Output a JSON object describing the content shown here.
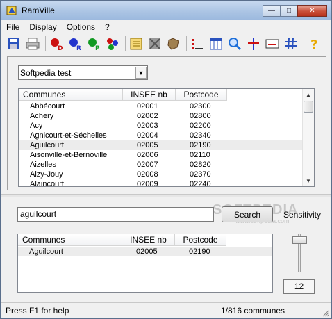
{
  "window": {
    "title": "RamVille",
    "minimize": "—",
    "maximize": "□",
    "close": "✕"
  },
  "menu": [
    "File",
    "Display",
    "Options",
    "?"
  ],
  "toolbar": {
    "colors": {
      "save": "#2a52be",
      "red": "#cc1111",
      "blue": "#2233cc",
      "green": "#119922",
      "purple": "#8833aa",
      "find": "#1e6fd9",
      "hash": "#2a52be",
      "help": "#e8a800"
    }
  },
  "combo": {
    "value": "Softpedia test"
  },
  "columns": {
    "commune": "Communes",
    "insee": "INSEE nb",
    "postcode": "Postcode"
  },
  "communes": [
    {
      "name": "Abbécourt",
      "insee": "02001",
      "postcode": "02300"
    },
    {
      "name": "Achery",
      "insee": "02002",
      "postcode": "02800"
    },
    {
      "name": "Acy",
      "insee": "02003",
      "postcode": "02200"
    },
    {
      "name": "Agnicourt-et-Séchelles",
      "insee": "02004",
      "postcode": "02340"
    },
    {
      "name": "Aguilcourt",
      "insee": "02005",
      "postcode": "02190"
    },
    {
      "name": "Aisonville-et-Bernoville",
      "insee": "02006",
      "postcode": "02110"
    },
    {
      "name": "Aizelles",
      "insee": "02007",
      "postcode": "02820"
    },
    {
      "name": "Aizy-Jouy",
      "insee": "02008",
      "postcode": "02370"
    },
    {
      "name": "Alaincourt",
      "insee": "02009",
      "postcode": "02240"
    }
  ],
  "search": {
    "value": "aguilcourt",
    "button": "Search"
  },
  "sensitivity": {
    "label": "Sensitivity",
    "value": "12"
  },
  "results": [
    {
      "name": "Aguilcourt",
      "insee": "02005",
      "postcode": "02190"
    }
  ],
  "status": {
    "help": "Press F1 for help",
    "count": "1/816 communes"
  },
  "watermark": {
    "main": "SOFTPEDIA",
    "sub": "www.softpedia.com"
  }
}
